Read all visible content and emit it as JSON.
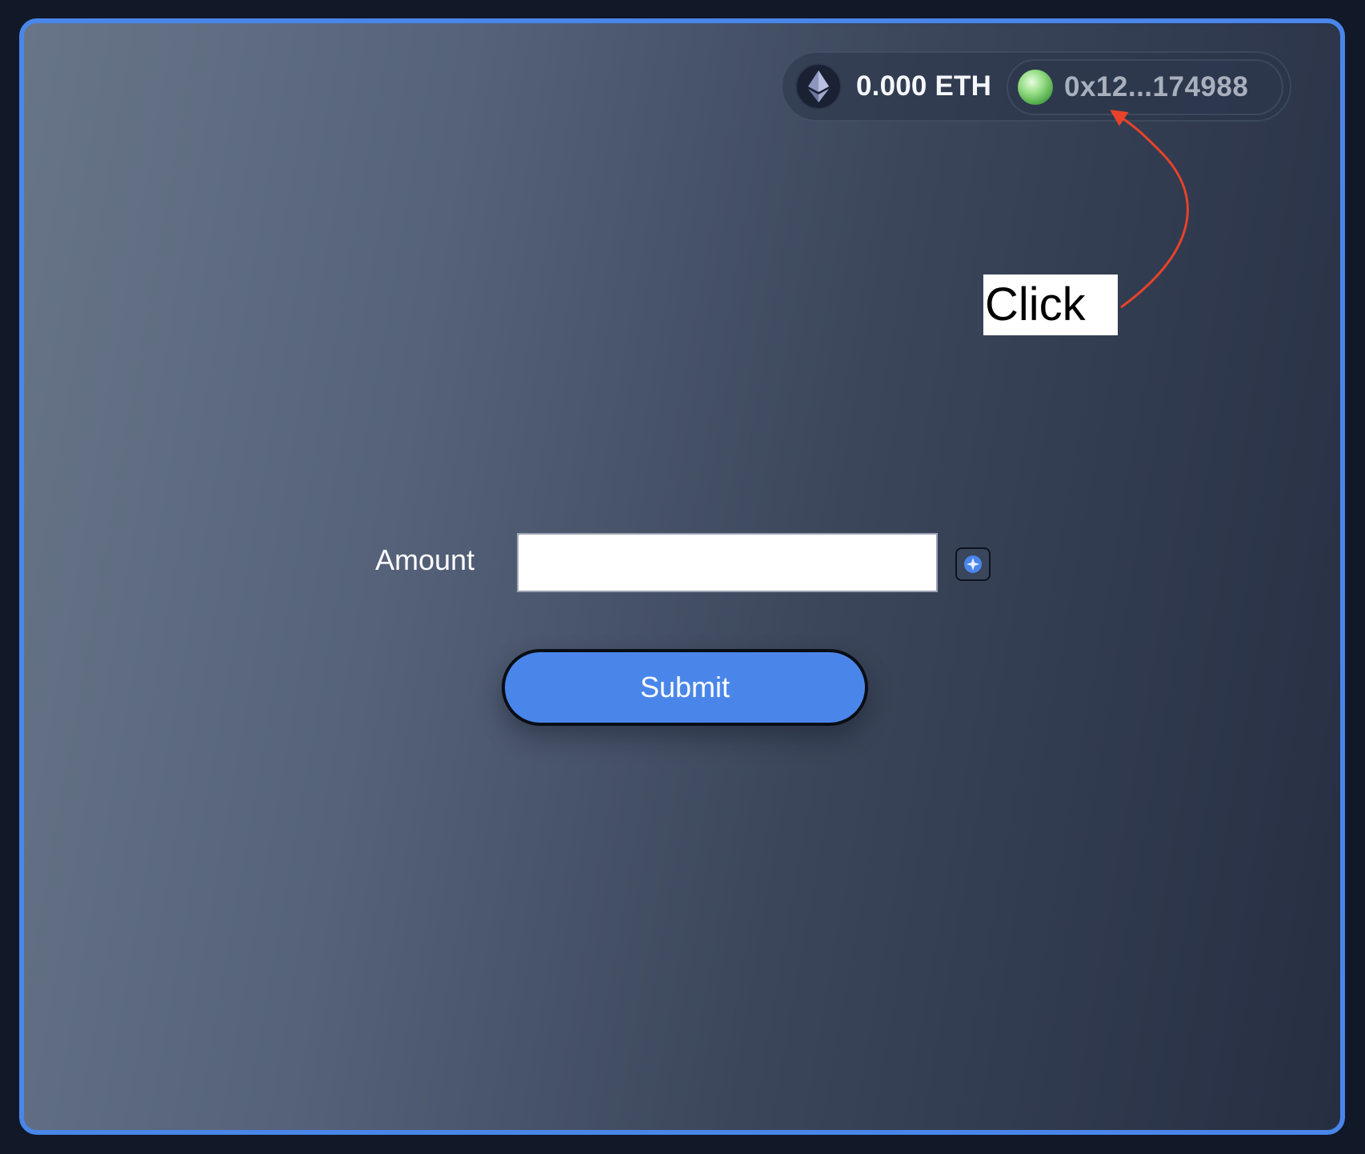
{
  "wallet": {
    "balance": "0.000 ETH",
    "address": "0x12...174988",
    "token_icon": "ethereum-icon",
    "avatar_icon": "account-avatar-icon"
  },
  "annotation": {
    "label": "Click",
    "arrow_color": "#e8432a"
  },
  "form": {
    "amount_label": "Amount",
    "amount_value": "",
    "amount_placeholder": "",
    "submit_label": "Submit"
  },
  "colors": {
    "accent": "#4a86ea",
    "background": "#111827"
  }
}
